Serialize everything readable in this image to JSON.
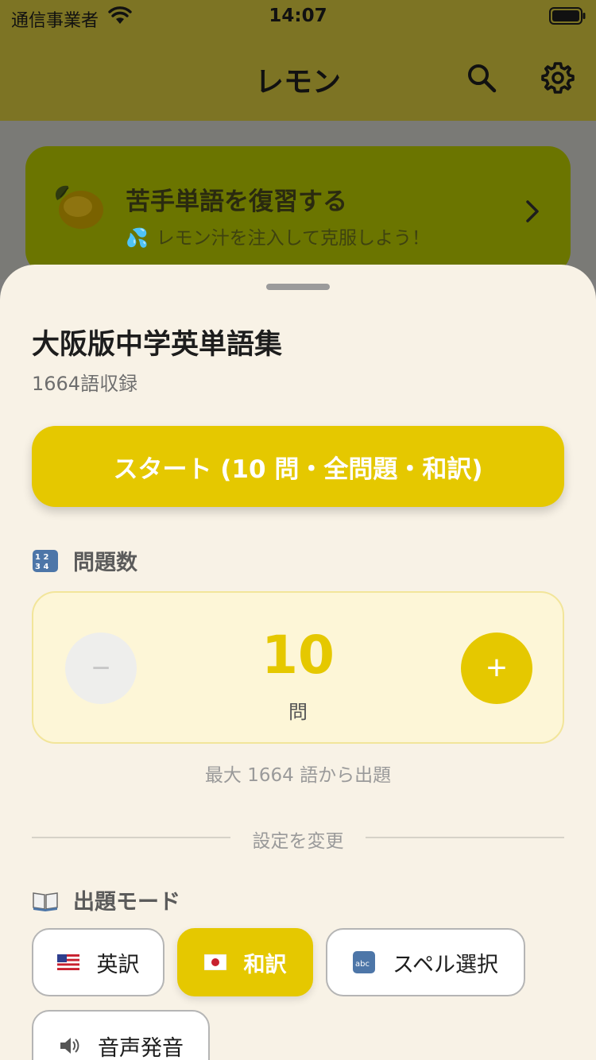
{
  "status_bar": {
    "carrier": "通信事業者",
    "time": "14:07"
  },
  "nav": {
    "title": "レモン",
    "icons": [
      "search-icon",
      "gear-icon"
    ]
  },
  "review_card": {
    "title": "苦手単語を復習する",
    "subtitle_emoji": "💦",
    "subtitle": "レモン汁を注入して克服しよう！",
    "icon": "lemon-icon"
  },
  "sheet": {
    "deck_title": "大阪版中学英単語集",
    "deck_count": "1664語収録",
    "start_button": "スタート (10 問・全問題・和訳)",
    "question_count": {
      "label": "問題数",
      "value": "10",
      "unit": "問",
      "minus": "−",
      "plus": "+",
      "max_note": "最大 1664 語から出題"
    },
    "divider_text": "設定を変更",
    "mode": {
      "label": "出題モード",
      "options": [
        {
          "label": "英訳",
          "icon": "us-flag-icon",
          "selected": false
        },
        {
          "label": "和訳",
          "icon": "jp-flag-icon",
          "selected": true
        },
        {
          "label": "スペル選択",
          "icon": "abc-icon",
          "selected": false
        },
        {
          "label": "音声発音",
          "icon": "speaker-icon",
          "selected": false
        }
      ]
    }
  },
  "colors": {
    "accent": "#e5c800",
    "sheet_bg": "#f8f2e6",
    "count_box_bg": "#fdf6d7"
  }
}
